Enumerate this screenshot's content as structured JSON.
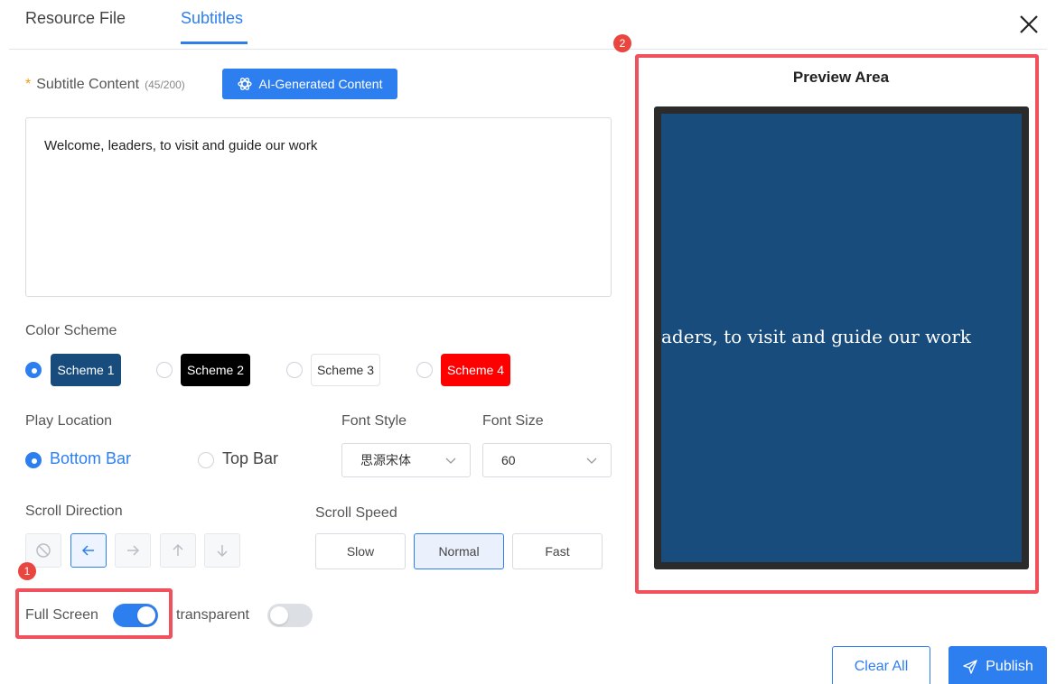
{
  "tabs": [
    {
      "label": "Resource File"
    },
    {
      "label": "Subtitles",
      "active": true
    }
  ],
  "subtitle": {
    "required_mark": "*",
    "label": "Subtitle Content",
    "count": "(45/200)",
    "ai_button": "AI-Generated Content",
    "content": "Welcome, leaders, to visit and guide our work"
  },
  "color_scheme": {
    "label": "Color Scheme",
    "selected": "Scheme 1",
    "options": [
      {
        "label": "Scheme 1",
        "bg": "#174c7d",
        "fg": "#ffffff"
      },
      {
        "label": "Scheme 2",
        "bg": "#000000",
        "fg": "#ffffff"
      },
      {
        "label": "Scheme 3",
        "bg": "#ffffff",
        "fg": "#333333"
      },
      {
        "label": "Scheme 4",
        "bg": "#ff0000",
        "fg": "#ffffff"
      }
    ]
  },
  "play_location": {
    "label": "Play Location",
    "selected": "Bottom Bar",
    "options": [
      {
        "label": "Bottom Bar"
      },
      {
        "label": "Top Bar"
      }
    ]
  },
  "font_style": {
    "label": "Font Style",
    "value": "思源宋体"
  },
  "font_size": {
    "label": "Font Size",
    "value": "60"
  },
  "scroll_direction": {
    "label": "Scroll Direction",
    "selected": "left",
    "options": [
      "none-icon",
      "arrow-left-icon",
      "arrow-right-icon",
      "arrow-up-icon",
      "arrow-down-icon"
    ]
  },
  "scroll_speed": {
    "label": "Scroll Speed",
    "selected": "Normal",
    "options": [
      {
        "label": "Slow"
      },
      {
        "label": "Normal"
      },
      {
        "label": "Fast"
      }
    ]
  },
  "toggles": {
    "full_screen": {
      "label": "Full Screen",
      "on": true
    },
    "transparent": {
      "label": "transparent",
      "on": false
    }
  },
  "preview": {
    "title": "Preview Area",
    "text": "aders, to visit and guide our work"
  },
  "annotations": {
    "badge1": "1",
    "badge2": "2"
  },
  "actions": {
    "clear": "Clear All",
    "publish": "Publish"
  },
  "colors": {
    "accent": "#2d7ff0",
    "highlight": "#f0515d",
    "preview_bg": "#174c7d"
  }
}
